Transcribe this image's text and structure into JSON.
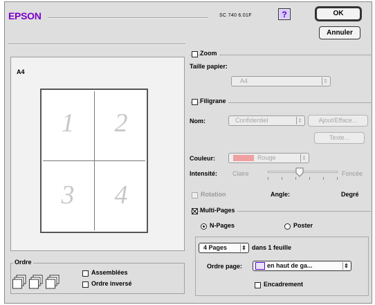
{
  "header": {
    "brand": "EPSON",
    "model": "SC 740 6.01F",
    "help_icon": "question-mark-icon",
    "brand_color": "#7a00c8"
  },
  "buttons": {
    "ok": "OK",
    "cancel": "Annuler"
  },
  "preview": {
    "paper": "A4",
    "pages": [
      "1",
      "2",
      "3",
      "4"
    ]
  },
  "order": {
    "title": "Ordre",
    "assembled": "Assemblées",
    "reverse": "Ordre inversé"
  },
  "zoom": {
    "label": "Zoom",
    "paper_size_label": "Taille papier:",
    "paper_size_value": "A4"
  },
  "watermark": {
    "label": "Filigrane",
    "name_label": "Nom:",
    "name_value": "Confidentiel",
    "add_delete": "Ajout/Efface...",
    "text_btn": "Texte...",
    "color_label": "Couleur:",
    "color_value": "Rouge",
    "color_swatch": "#f0a0a0",
    "intensity_label": "Intensité:",
    "light": "Claire",
    "dark": "Foncée",
    "rotation": "Rotation",
    "angle": "Angle:",
    "degree": "Degré"
  },
  "multipages": {
    "label": "Multi-Pages",
    "npages": "N-Pages",
    "poster": "Poster",
    "pages_value": "4 Pages",
    "per_sheet": "dans 1 feuille",
    "page_order_label": "Ordre page:",
    "page_order_value": "en haut de ga...",
    "frame": "Encadrement"
  }
}
